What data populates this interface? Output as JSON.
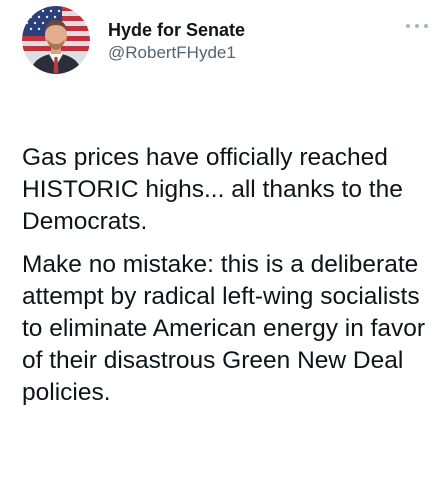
{
  "account": {
    "display_name": "Hyde for Senate",
    "handle": "@RobertFHyde1"
  },
  "menu": {
    "icon": "more-options-icon"
  },
  "tweet": {
    "paragraph_1": "Gas prices have officially reached HISTORIC highs... all thanks to the Democrats.",
    "paragraph_2": "Make no mistake: this is a deliberate attempt by radical left-wing socialists to eliminate American energy in favor of their disastrous Green New Deal policies."
  },
  "colors": {
    "text": "#0f1419",
    "secondary_text": "#536471",
    "dots": "#aab4bd"
  }
}
